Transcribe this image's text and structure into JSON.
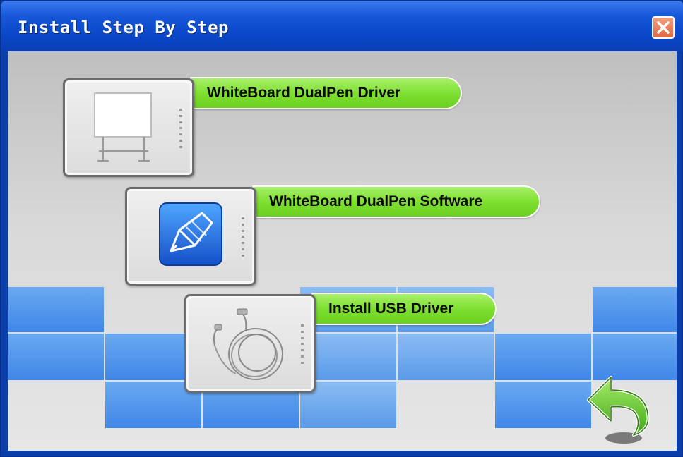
{
  "window": {
    "title": "Install Step By Step",
    "close_icon": "close-x-icon"
  },
  "items": [
    {
      "label": "WhiteBoard DualPen Driver",
      "icon": "whiteboard-icon"
    },
    {
      "label": "WhiteBoard DualPen Software",
      "icon": "pen-software-icon"
    },
    {
      "label": "Install USB Driver",
      "icon": "usb-cable-icon"
    }
  ],
  "back": {
    "icon": "back-arrow-icon"
  },
  "colors": {
    "title_bar": "#1657d8",
    "pill_green": "#7ee030",
    "tile_blue": "#4f92ea",
    "close_orange": "#e06640"
  }
}
